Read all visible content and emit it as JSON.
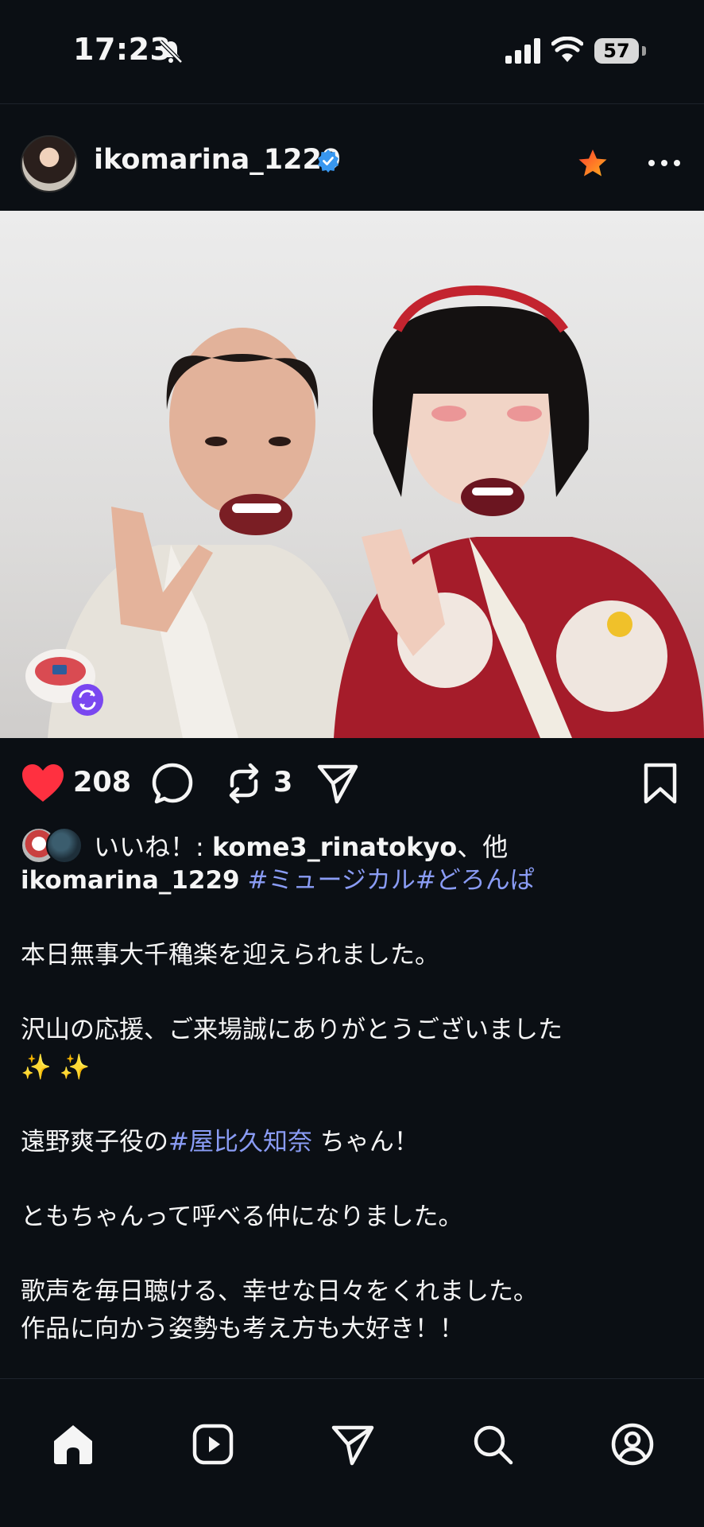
{
  "status_bar": {
    "time": "17:23",
    "battery": "57",
    "icons": [
      "bell-muted-icon",
      "cellular-signal-icon",
      "wifi-icon",
      "battery-icon"
    ]
  },
  "post": {
    "username": "ikomarina_1229",
    "verified": true,
    "like_count": "208",
    "repost_count": "3",
    "liked_by_prefix": "いいね！: ",
    "liked_by_user": "kome3_rinatokyo",
    "liked_by_suffix": "、他",
    "caption": {
      "author": "ikomarina_1229",
      "hashtags": "#ミュージカル#どろんぱ",
      "line1": "本日無事大千穐楽を迎えられました。",
      "line2a": "沢山の応援、ご来場誠にありがとうございました",
      "line2b": "✨ ✨",
      "line3_prefix": "遠野爽子役の",
      "line3_tag": "#屋比久知奈",
      "line3_suffix": " ちゃん！",
      "line4": "ともちゃんって呼べる仲になりました。",
      "line5": "歌声を毎日聴ける、幸せな日々をくれました。",
      "line6": "作品に向かう姿勢も考え方も大好き！！"
    }
  },
  "colors": {
    "background": "#0b0f14",
    "like_red": "#ff3040",
    "hashtag": "#8a9cf5",
    "verified_blue": "#3897f0",
    "star_orange": "#ff5a1f"
  },
  "bottom_nav": [
    "home-icon",
    "reels-icon",
    "send-icon",
    "search-icon",
    "profile-icon"
  ]
}
